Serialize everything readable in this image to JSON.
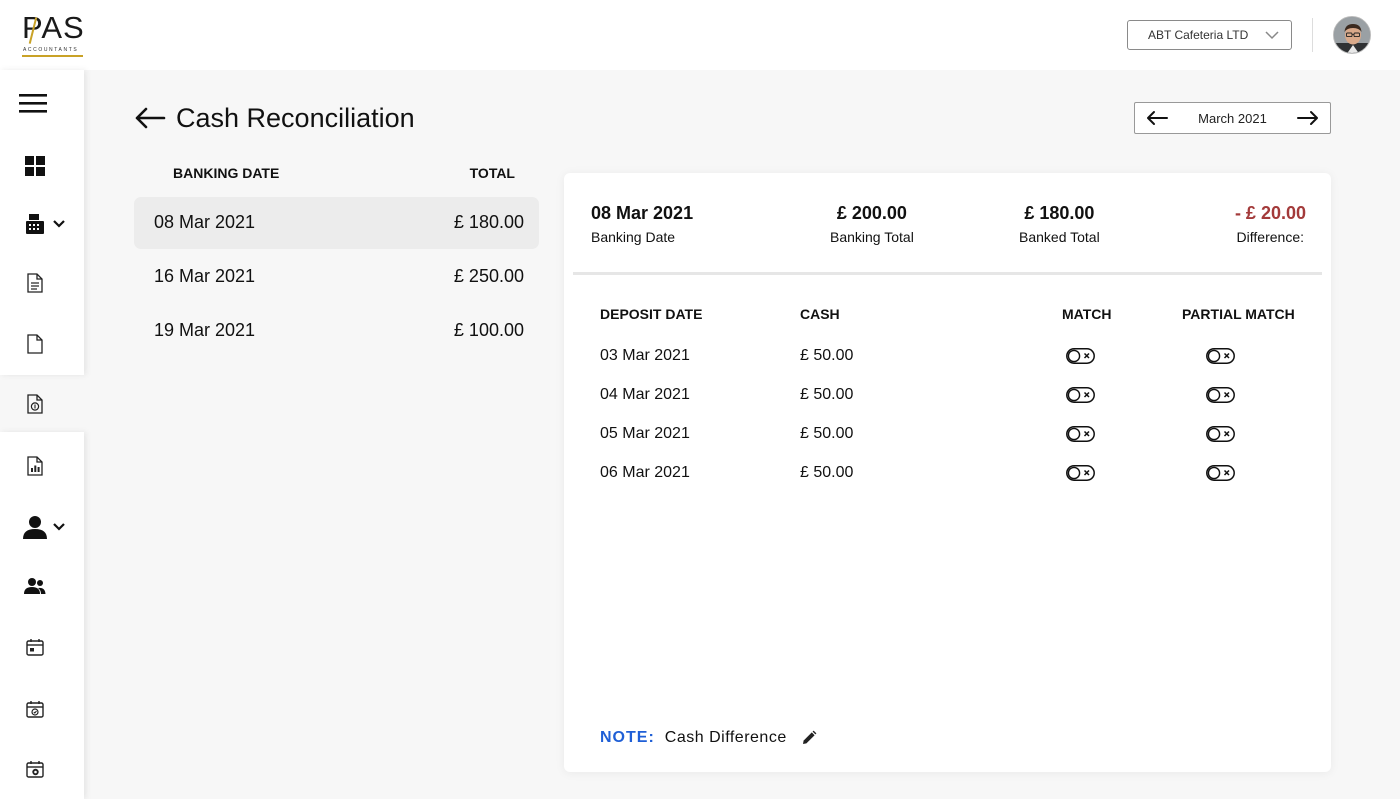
{
  "brand": {
    "logo_main": "PAS",
    "logo_sub": "ACCOUNTANTS"
  },
  "header": {
    "company": "ABT Cafeteria LTD"
  },
  "page": {
    "title": "Cash Reconciliation",
    "month": "March 2021"
  },
  "banking_list": {
    "col_date": "BANKING DATE",
    "col_total": "TOTAL",
    "rows": [
      {
        "date": "08 Mar 2021",
        "total": "£ 180.00"
      },
      {
        "date": "16 Mar 2021",
        "total": "£ 250.00"
      },
      {
        "date": "19 Mar 2021",
        "total": "£ 100.00"
      }
    ]
  },
  "summary": {
    "banking_date": {
      "value": "08 Mar 2021",
      "label": "Banking Date"
    },
    "banking_total": {
      "value": "£ 200.00",
      "label": "Banking Total"
    },
    "banked_total": {
      "value": "£ 180.00",
      "label": "Banked Total"
    },
    "difference": {
      "value": "- £ 20.00",
      "label": "Difference:"
    }
  },
  "deposits": {
    "headers": {
      "date": "DEPOSIT DATE",
      "cash": "CASH",
      "match": "MATCH",
      "partial": "PARTIAL MATCH"
    },
    "rows": [
      {
        "date": "03 Mar 2021",
        "cash": "£ 50.00",
        "match": false,
        "partial": false
      },
      {
        "date": "04 Mar 2021",
        "cash": "£ 50.00",
        "match": false,
        "partial": false
      },
      {
        "date": "05 Mar 2021",
        "cash": "£ 50.00",
        "match": false,
        "partial": false
      },
      {
        "date": "06 Mar 2021",
        "cash": "£ 50.00",
        "match": false,
        "partial": false
      }
    ]
  },
  "note": {
    "key": "NOTE:",
    "text": "Cash Difference"
  },
  "colors": {
    "difference": "#a33a3a",
    "note_key": "#1f5fd6",
    "selected_row": "#ececec"
  }
}
